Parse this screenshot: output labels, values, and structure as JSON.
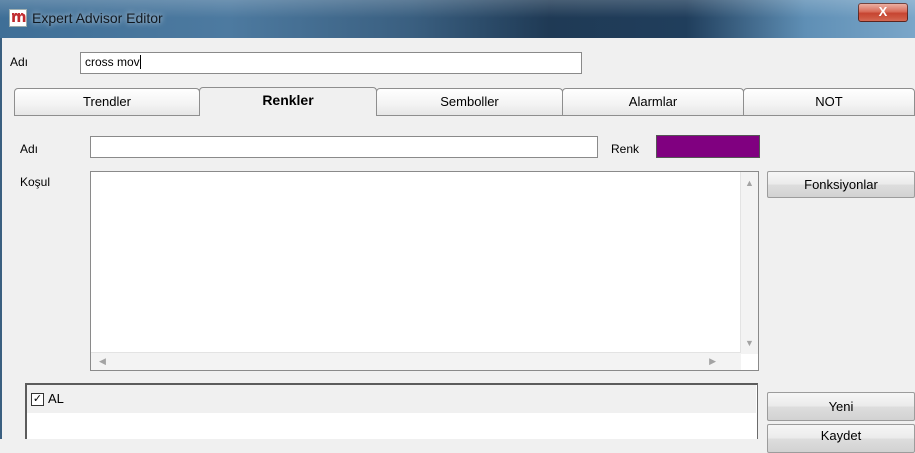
{
  "window": {
    "title": "Expert Advisor Editor",
    "close_glyph": "X"
  },
  "top": {
    "name_label": "Adı",
    "name_value": "cross mov"
  },
  "tabs": [
    {
      "label": "Trendler",
      "active": false
    },
    {
      "label": "Renkler",
      "active": true
    },
    {
      "label": "Semboller",
      "active": false
    },
    {
      "label": "Alarmlar",
      "active": false
    },
    {
      "label": "NOT",
      "active": false
    }
  ],
  "renkler": {
    "name_label": "Adı",
    "name_value": "",
    "color_label": "Renk",
    "color_value": "#800080",
    "condition_label": "Koşul",
    "condition_value": "",
    "functions_button": "Fonksiyonlar"
  },
  "list": {
    "items": [
      {
        "label": "AL",
        "checked": true
      }
    ]
  },
  "buttons": {
    "new": "Yeni",
    "save": "Kaydet"
  }
}
